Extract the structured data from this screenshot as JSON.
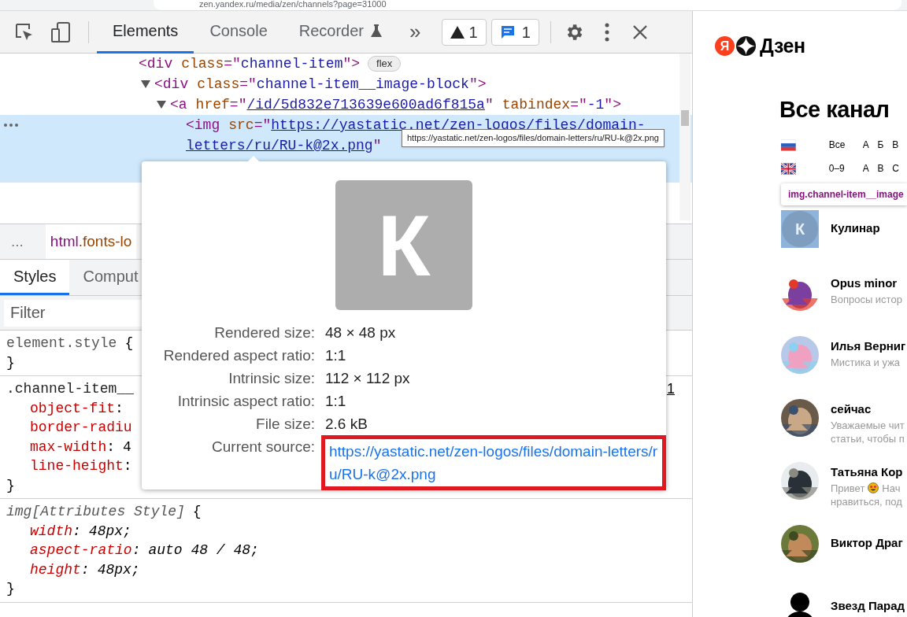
{
  "address_bar": {
    "url": "zen.yandex.ru/media/zen/channels?page=31000"
  },
  "devtools": {
    "tabs": [
      {
        "label": "Elements",
        "selected": true
      },
      {
        "label": "Console",
        "selected": false
      },
      {
        "label": "Recorder",
        "selected": false
      }
    ],
    "more_tabs": "»",
    "warnings_count": "1",
    "messages_count": "1",
    "dom_tree": [
      {
        "selected": false,
        "badge": "flex",
        "rows": [
          {
            "tokens": [
              {
                "kind": "tag",
                "text": "<div"
              },
              {
                "kind": "attr",
                "text": "class"
              },
              {
                "kind": "punct",
                "text": "=\""
              },
              {
                "kind": "val",
                "text": "channel-item"
              },
              {
                "kind": "punct",
                "text": "\">"
              }
            ]
          }
        ],
        "children": [
          {
            "expanded": true,
            "selected": false,
            "rows": [
              {
                "tokens": [
                  {
                    "kind": "tag",
                    "text": "<div"
                  },
                  {
                    "kind": "attr",
                    "text": "class"
                  },
                  {
                    "kind": "punct",
                    "text": "=\""
                  },
                  {
                    "kind": "val",
                    "text": "channel-item__image-block"
                  },
                  {
                    "kind": "punct",
                    "text": "\">"
                  }
                ]
              }
            ],
            "children": [
              {
                "expanded": true,
                "selected": false,
                "rows": [
                  {
                    "tokens": [
                      {
                        "kind": "tag",
                        "text": "<a"
                      },
                      {
                        "kind": "attr",
                        "text": "href"
                      },
                      {
                        "kind": "punct",
                        "text": "=\""
                      },
                      {
                        "kind": "link",
                        "text": "/id/5d832e713639e600ad6f815a"
                      },
                      {
                        "kind": "punct",
                        "text": "\""
                      },
                      {
                        "kind": "attr",
                        "text": "tabindex"
                      },
                      {
                        "kind": "punct",
                        "text": "=\""
                      },
                      {
                        "kind": "val",
                        "text": "-1"
                      },
                      {
                        "kind": "punct",
                        "text": "\">"
                      }
                    ]
                  }
                ],
                "children": [
                  {
                    "selected": true,
                    "rows": [
                      {
                        "tokens": [
                          {
                            "kind": "tag",
                            "text": "<img"
                          },
                          {
                            "kind": "attr",
                            "text": "src"
                          },
                          {
                            "kind": "punct",
                            "text": "=\""
                          },
                          {
                            "kind": "link",
                            "text": "https://yastatic.net/zen-logos/files/domain-"
                          }
                        ]
                      },
                      {
                        "tokens": [
                          {
                            "kind": "link",
                            "text": "letters/ru/RU-k@2x.png"
                          },
                          {
                            "kind": "punct",
                            "text": "\""
                          }
                        ]
                      }
                    ]
                  }
                ]
              }
            ]
          }
        ]
      }
    ],
    "link_tooltip": "https://yastatic.net/zen-logos/files/domain-letters/ru/RU-k@2x.png",
    "breadcrumb": {
      "overflow": "...",
      "tag": "html",
      "classes": ".fonts-lo"
    },
    "style_tabs": [
      {
        "label": "Styles",
        "selected": true
      },
      {
        "label": "Comput",
        "selected": false
      }
    ],
    "filter": {
      "placeholder": "Filter"
    },
    "rules": [
      {
        "kind": "inline",
        "selector": "element.style",
        "open": "{",
        "close": "}"
      },
      {
        "kind": "rule",
        "selector": ".channel-item__",
        "source": "1",
        "close": "}",
        "declarations": [
          {
            "property": "object-fit",
            "colon": ":"
          },
          {
            "property": "border-radiu"
          },
          {
            "property": "max-width",
            "colon": ":",
            "value": "4"
          },
          {
            "property": "line-height",
            "colon": ":"
          }
        ]
      },
      {
        "kind": "attributes",
        "selector": "img[Attributes Style]",
        "open": "{",
        "close": "}",
        "declarations": [
          {
            "property": "width",
            "colon": ":",
            "value": "48px;"
          },
          {
            "property": "aspect-ratio",
            "colon": ":",
            "value": "auto 48 / 48;"
          },
          {
            "property": "height",
            "colon": ":",
            "value": "48px;"
          }
        ]
      }
    ],
    "image_popover": {
      "preview_letter": "К",
      "rows": [
        {
          "label": "Rendered size:",
          "value": "48 × 48 px"
        },
        {
          "label": "Rendered aspect ratio:",
          "value": "1:1"
        },
        {
          "label": "Intrinsic size:",
          "value": "112 × 112 px"
        },
        {
          "label": "Intrinsic aspect ratio:",
          "value": "1:1"
        },
        {
          "label": "File size:",
          "value": "2.6 kB"
        },
        {
          "label": "Current source:",
          "value": "https://yastatic.net/zen-logos/files/domain-letters/ru/RU-k@2x.png",
          "kind": "link",
          "highlighted": true
        }
      ]
    }
  },
  "page": {
    "logo": {
      "letter": "Я",
      "name": "Дзен"
    },
    "heading": "Все канал",
    "filters": [
      {
        "kind": "ru",
        "first": "Все",
        "letters": [
          "А",
          "Б",
          "В"
        ]
      },
      {
        "kind": "en",
        "first": "0–9",
        "letters": [
          "A",
          "B",
          "C"
        ]
      }
    ],
    "element_tooltip": "img.channel-item__image",
    "channels": [
      {
        "name": "Кулинар",
        "kind": "letter",
        "letter": "К",
        "highlighted": true
      },
      {
        "name": "Opus minor",
        "kind": "picture",
        "highlighted": false,
        "description_lines": [
          [
            "Вопросы истор"
          ]
        ]
      },
      {
        "name": "Илья Верниг",
        "kind": "picture",
        "highlighted": false,
        "description_lines": [
          [
            "Мистика и ужа"
          ]
        ]
      },
      {
        "name": "сейчас",
        "kind": "picture",
        "highlighted": false,
        "description_lines": [
          [
            "Уважаемые чит"
          ],
          [
            "статьи, чтобы п"
          ]
        ]
      },
      {
        "name": "Татьяна Кор",
        "kind": "picture",
        "highlighted": false,
        "description_lines": [
          [
            "Привет",
            "Нач"
          ],
          [
            "нравиться, под"
          ]
        ]
      },
      {
        "name": "Виктор Драг",
        "kind": "picture",
        "highlighted": false
      },
      {
        "name": "Звезд Парад",
        "kind": "silhouette",
        "highlighted": false
      }
    ]
  }
}
